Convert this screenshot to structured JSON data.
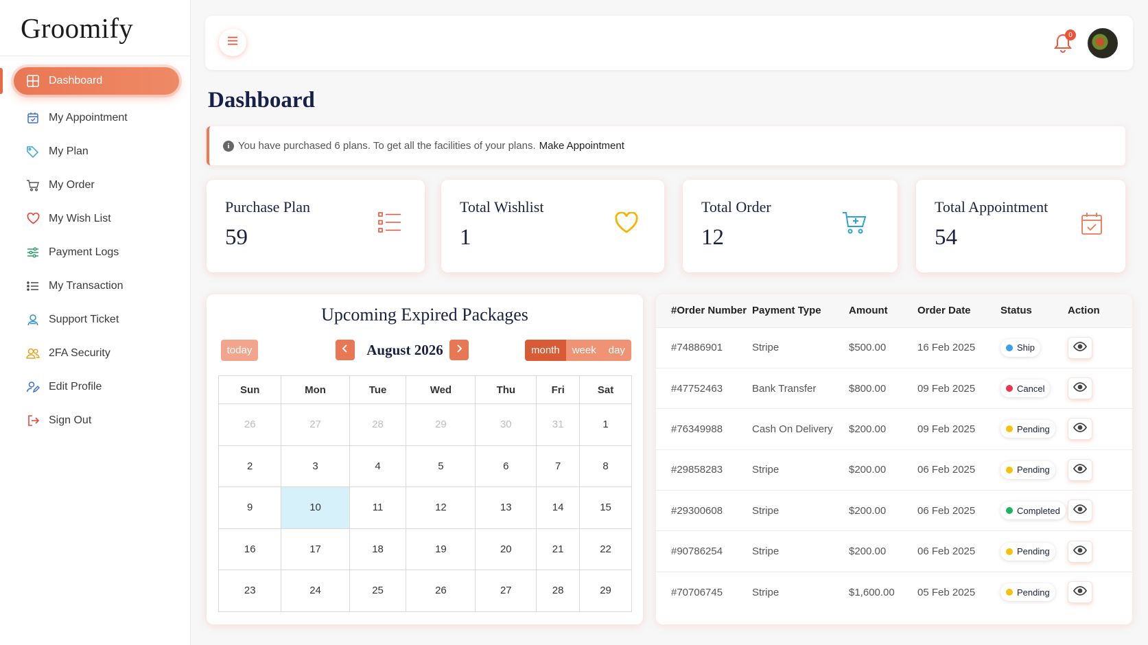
{
  "brand": {
    "name": "Groomify",
    "accent": "#EA7754",
    "title_color": "#18204A"
  },
  "sidebar": {
    "items": [
      {
        "label": "Dashboard",
        "icon": "dashboard-grid-icon",
        "active": true
      },
      {
        "label": "My Appointment",
        "icon": "calendar-icon"
      },
      {
        "label": "My Plan",
        "icon": "tag-icon"
      },
      {
        "label": "My Order",
        "icon": "cart-icon"
      },
      {
        "label": "My Wish List",
        "icon": "heart-icon"
      },
      {
        "label": "Payment Logs",
        "icon": "sliders-icon"
      },
      {
        "label": "My Transaction",
        "icon": "list-icon"
      },
      {
        "label": "Support Ticket",
        "icon": "support-user-icon"
      },
      {
        "label": "2FA Security",
        "icon": "users-icon"
      },
      {
        "label": "Edit Profile",
        "icon": "edit-user-icon"
      },
      {
        "label": "Sign Out",
        "icon": "sign-out-icon"
      }
    ]
  },
  "topbar": {
    "notification_count": "0"
  },
  "page": {
    "title": "Dashboard"
  },
  "alert": {
    "text": "You have purchased 6 plans. To get all the facilities of your plans.",
    "link": "Make Appointment"
  },
  "stats": [
    {
      "label": "Purchase Plan",
      "value": "59",
      "icon": "list-icon"
    },
    {
      "label": "Total Wishlist",
      "value": "1",
      "icon": "heart-icon"
    },
    {
      "label": "Total Order",
      "value": "12",
      "icon": "cart-icon"
    },
    {
      "label": "Total Appointment",
      "value": "54",
      "icon": "calendar-check-icon"
    }
  ],
  "calendar": {
    "title": "Upcoming Expired Packages",
    "today_label": "today",
    "month_label": "August 2026",
    "views": [
      "month",
      "week",
      "day"
    ],
    "active_view": "month",
    "weekdays": [
      "Sun",
      "Mon",
      "Tue",
      "Wed",
      "Thu",
      "Fri",
      "Sat"
    ],
    "weeks": [
      [
        "26",
        "27",
        "28",
        "29",
        "30",
        "31",
        "1"
      ],
      [
        "2",
        "3",
        "4",
        "5",
        "6",
        "7",
        "8"
      ],
      [
        "9",
        "10",
        "11",
        "12",
        "13",
        "14",
        "15"
      ],
      [
        "16",
        "17",
        "18",
        "19",
        "20",
        "21",
        "22"
      ],
      [
        "23",
        "24",
        "25",
        "26",
        "27",
        "28",
        "29"
      ]
    ],
    "highlighted_day": "10"
  },
  "orders": {
    "columns": [
      "#Order Number",
      "Payment Type",
      "Amount",
      "Order Date",
      "Status",
      "Action"
    ],
    "rows": [
      {
        "number": "#74886901",
        "payment": "Stripe",
        "amount": "$500.00",
        "date": "16 Feb 2025",
        "status": "Ship",
        "status_color": "#3AA0E8"
      },
      {
        "number": "#47752463",
        "payment": "Bank Transfer",
        "amount": "$800.00",
        "date": "09 Feb 2025",
        "status": "Cancel",
        "status_color": "#E8364F"
      },
      {
        "number": "#76349988",
        "payment": "Cash On Delivery",
        "amount": "$200.00",
        "date": "09 Feb 2025",
        "status": "Pending",
        "status_color": "#F4C20D"
      },
      {
        "number": "#29858283",
        "payment": "Stripe",
        "amount": "$200.00",
        "date": "06 Feb 2025",
        "status": "Pending",
        "status_color": "#F4C20D"
      },
      {
        "number": "#29300608",
        "payment": "Stripe",
        "amount": "$200.00",
        "date": "06 Feb 2025",
        "status": "Completed",
        "status_color": "#22B35E"
      },
      {
        "number": "#90786254",
        "payment": "Stripe",
        "amount": "$200.00",
        "date": "06 Feb 2025",
        "status": "Pending",
        "status_color": "#F4C20D"
      },
      {
        "number": "#70706745",
        "payment": "Stripe",
        "amount": "$1,600.00",
        "date": "05 Feb 2025",
        "status": "Pending",
        "status_color": "#F4C20D"
      }
    ]
  }
}
